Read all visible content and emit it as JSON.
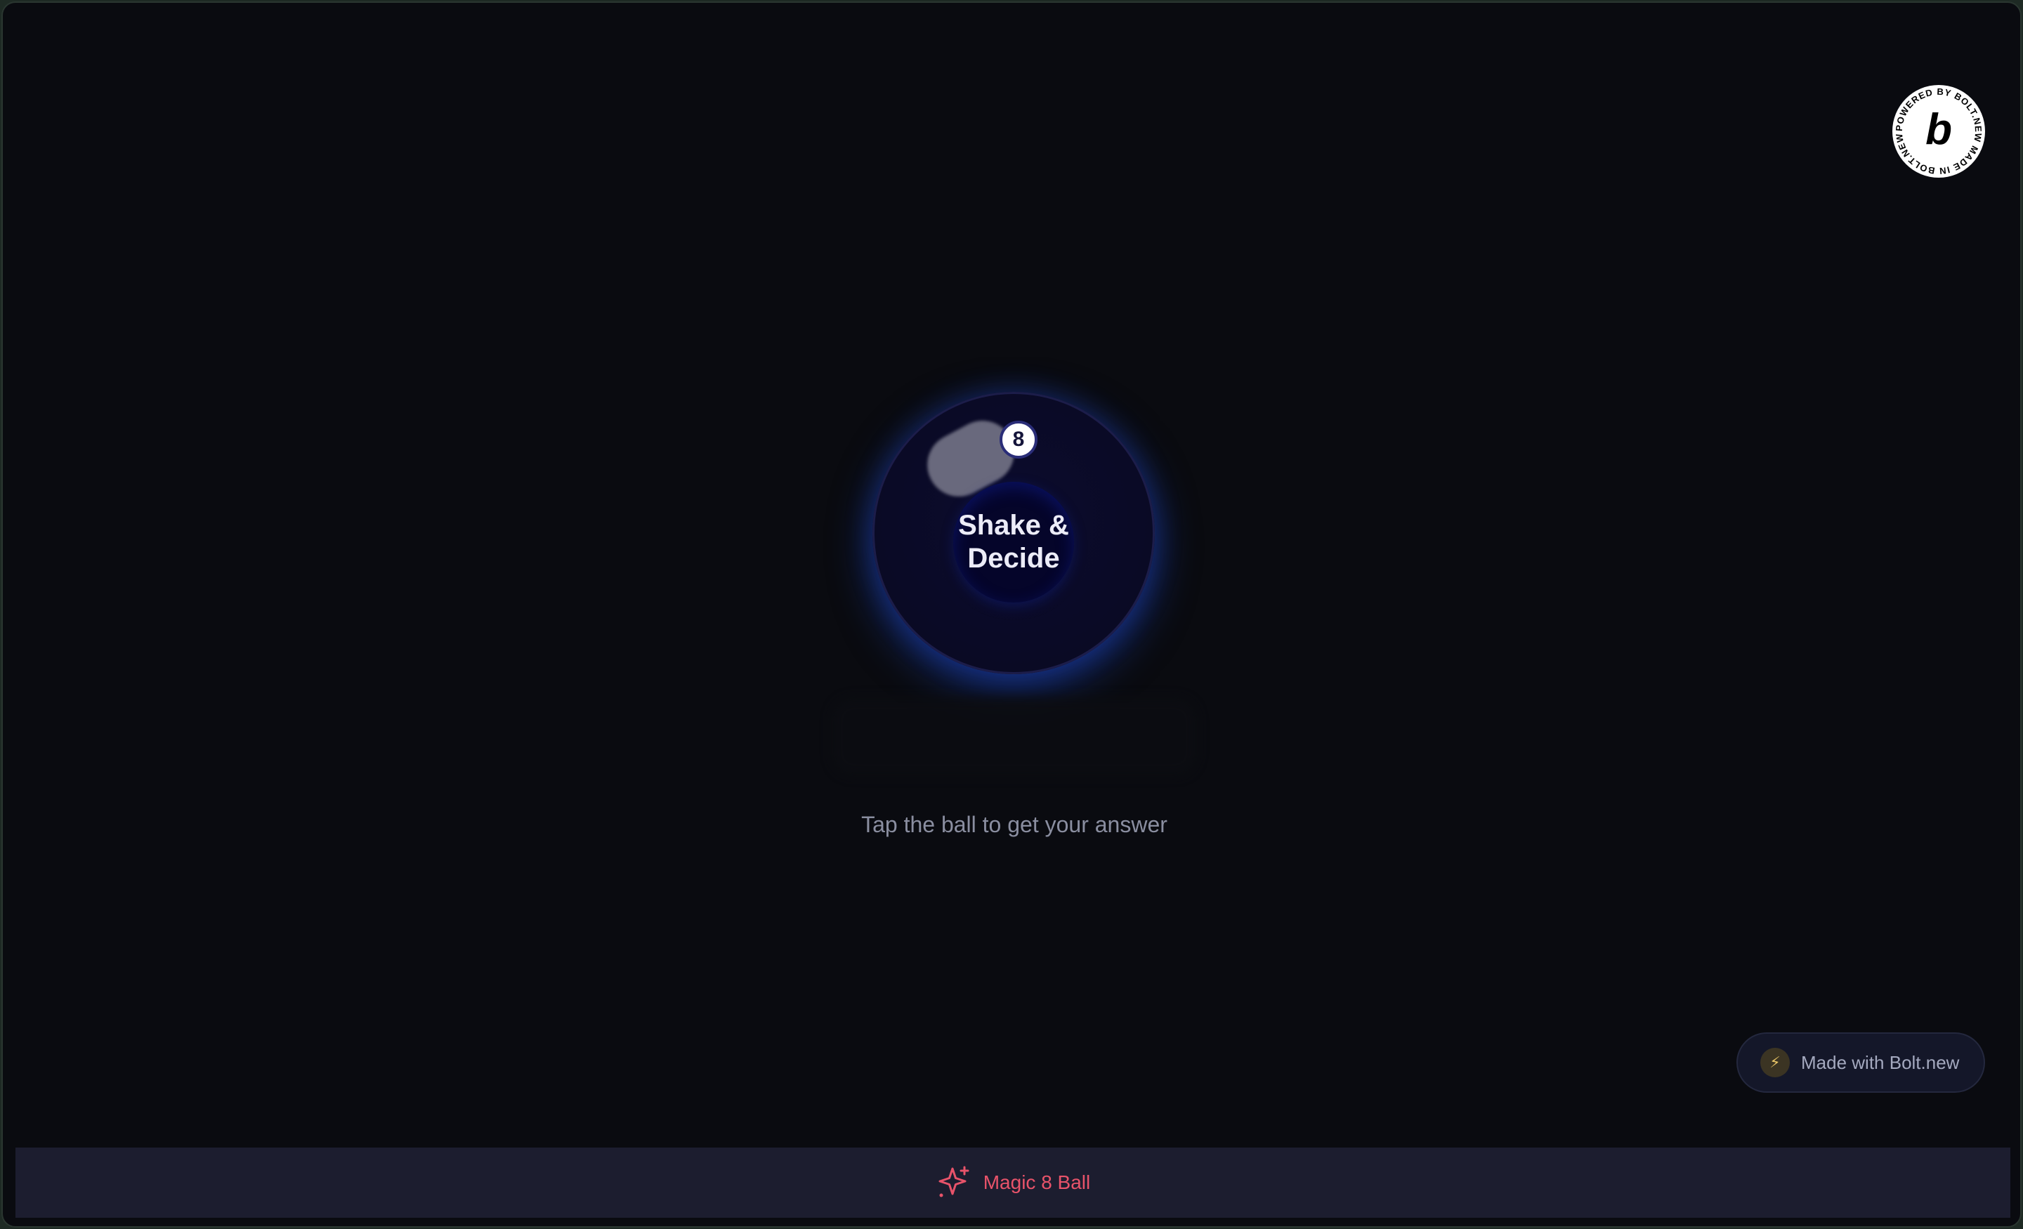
{
  "badge": {
    "icon": "bolt-b-icon",
    "ring_text": "POWERED BY BOLT.NEW MADE IN BOLT.NEW ",
    "letter": "b"
  },
  "ball": {
    "number": "8",
    "window_line1": "Shake &",
    "window_line2": "Decide",
    "glow_color": "#1e50e6"
  },
  "hint": "Tap the ball to get your answer",
  "made_with": {
    "icon": "lightning-icon",
    "label": "Made with Bolt.new"
  },
  "footer": {
    "icon": "sparkles-icon",
    "title": "Magic 8 Ball",
    "accent": "#e8536a"
  }
}
